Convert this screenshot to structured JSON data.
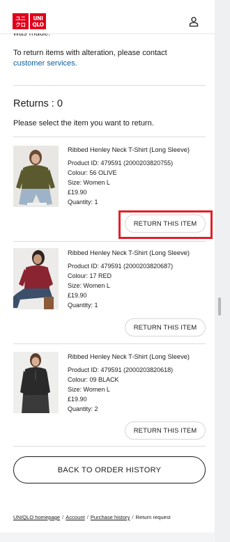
{
  "header": {
    "logo_top": "ユニクロ",
    "logo_bottom": "UNIQLO",
    "logo_block_1": [
      "ユニ",
      "クロ"
    ],
    "logo_block_2": [
      "UNI",
      "QLO"
    ],
    "user_icon": "user-icon"
  },
  "partial_text": "was made.",
  "note": {
    "text": "To return items with alteration, please contact",
    "link": "customer services."
  },
  "returns": {
    "heading": "Returns : 0",
    "instruction": "Please select the item you want to return."
  },
  "items": [
    {
      "name": "Ribbed Henley Neck T-Shirt (Long Sleeve)",
      "product_id": "Product ID: 479591 (2000203820755)",
      "colour": "Colour: 56 OLIVE",
      "size": "Size: Women L",
      "price": "£19.90",
      "quantity": "Quantity: 1",
      "button": "RETURN THIS ITEM",
      "shirt_color": "#5a5a2e"
    },
    {
      "name": "Ribbed Henley Neck T-Shirt (Long Sleeve)",
      "product_id": "Product ID: 479591 (2000203820687)",
      "colour": "Colour: 17 RED",
      "size": "Size: Women L",
      "price": "£19.90",
      "quantity": "Quantity: 1",
      "button": "RETURN THIS ITEM",
      "shirt_color": "#8a2430"
    },
    {
      "name": "Ribbed Henley Neck T-Shirt (Long Sleeve)",
      "product_id": "Product ID: 479591 (2000203820618)",
      "colour": "Colour: 09 BLACK",
      "size": "Size: Women L",
      "price": "£19.90",
      "quantity": "Quantity: 2",
      "button": "RETURN THIS ITEM",
      "shirt_color": "#2a2a2a"
    }
  ],
  "back_button": "BACK TO ORDER HISTORY",
  "breadcrumb": {
    "home": "UNIQLO homepage",
    "account": "Account",
    "history": "Purchase history",
    "current": "Return request",
    "separator": "/"
  },
  "colors": {
    "brand_red": "#e0001b",
    "link_blue": "#0b5e9f",
    "highlight_red": "#e0202a"
  }
}
